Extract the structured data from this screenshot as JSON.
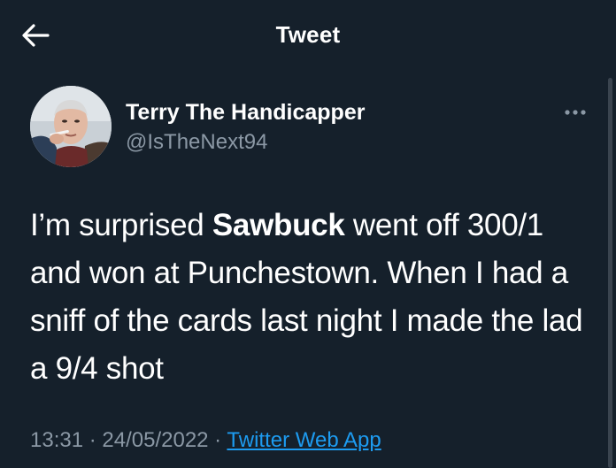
{
  "header": {
    "title": "Tweet",
    "back_icon": "arrow-left-icon"
  },
  "author": {
    "display_name": "Terry The Handicapper",
    "handle": "@IsTheNext94",
    "more_icon": "more-horizontal-icon"
  },
  "tweet": {
    "text_before": "I’m surprised ",
    "text_bold": "Sawbuck",
    "text_after": " went off 300/1 and won at Punchestown. When I had a sniff of the cards last night I made the lad a 9/4 shot"
  },
  "meta": {
    "time": "13:31",
    "separator": " · ",
    "date": "24/05/2022",
    "separator2": " · ",
    "source": "Twitter Web App"
  },
  "colors": {
    "background": "#15202b",
    "secondary_text": "#8b98a5",
    "link": "#1d9bf0"
  }
}
